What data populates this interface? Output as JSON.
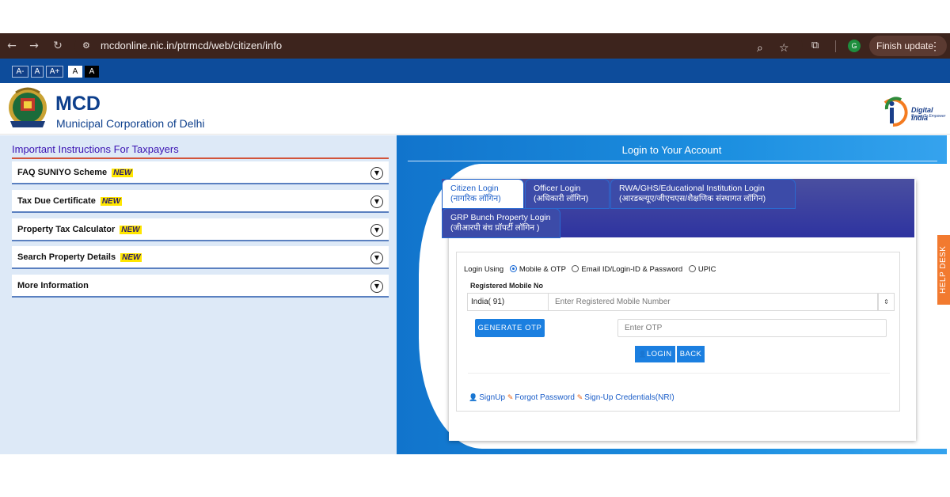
{
  "browser": {
    "url": "mcdonline.nic.in/ptrmcd/web/citizen/info",
    "finish_update": "Finish update",
    "profile_initial": "G",
    "menu_dots": "⋮"
  },
  "accessibility": {
    "font_decrease": "A-",
    "font_normal": "A",
    "font_increase": "A+",
    "contrast_light": "A",
    "contrast_dark": "A"
  },
  "header": {
    "title": "MCD",
    "subtitle": "Municipal Corporation of Delhi",
    "digital_india": "Digital India",
    "digital_india_tagline": "Power To Empower"
  },
  "instructions": {
    "title": "Important Instructions For Taxpayers",
    "new_badge": "NEW",
    "items": [
      {
        "label": "FAQ SUNIYO Scheme",
        "is_new": true
      },
      {
        "label": "Tax Due Certificate",
        "is_new": true
      },
      {
        "label": "Property Tax Calculator",
        "is_new": true
      },
      {
        "label": "Search Property Details",
        "is_new": true
      },
      {
        "label": "More Information",
        "is_new": false
      }
    ]
  },
  "login": {
    "heading": "Login to Your Account",
    "tabs": [
      {
        "label": "Citizen Login",
        "hindi": "(नागरिक लॉगिन)",
        "active": true
      },
      {
        "label": "Officer Login",
        "hindi": "(अधिकारी लॉगिन)",
        "active": false
      },
      {
        "label": "RWA/GHS/Educational Institution Login",
        "hindi": "(आरडब्ल्यूए/जीएचएस/शैक्षणिक संस्थागत लॉगिन)",
        "active": false
      },
      {
        "label": "GRP Bunch Property Login",
        "hindi": "(जीआरपी बंच प्रॉपर्टी लॉगिन )",
        "active": false
      }
    ],
    "login_using_label": "Login Using",
    "options": [
      {
        "label": "Mobile & OTP",
        "selected": true
      },
      {
        "label": "Email ID/Login-ID & Password",
        "selected": false
      },
      {
        "label": "UPIC",
        "selected": false
      }
    ],
    "mobile_label": "Registered Mobile No",
    "country_value": "India( 91)",
    "mobile_placeholder": "Enter Registered Mobile Number",
    "generate_otp": "GENERATE OTP",
    "otp_placeholder": "Enter OTP",
    "login_button": "LOGIN",
    "back_button": "BACK",
    "links": {
      "signup": "SignUp",
      "forgot_password": "Forgot Password",
      "signup_nri": "Sign-Up Credentials(NRI)"
    }
  },
  "help_desk": "HELP DESK"
}
